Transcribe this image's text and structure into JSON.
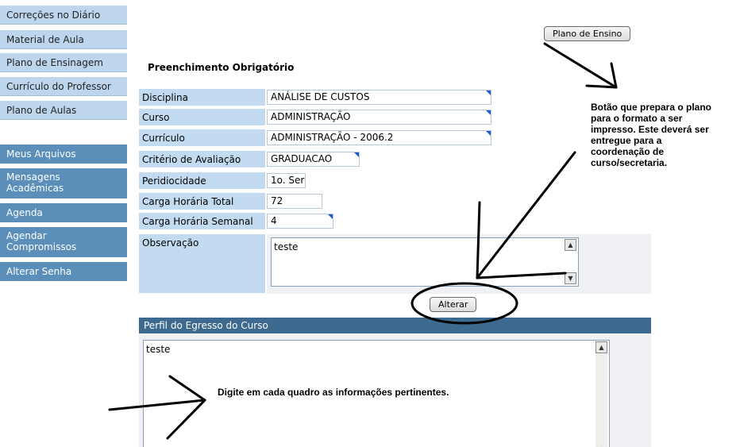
{
  "menu": {
    "light_items": [
      "Correções no Diário",
      "Material de Aula",
      "Plano de Ensinagem",
      "Currículo do Professor",
      "Plano de Aulas"
    ],
    "dark_items": [
      "Meus Arquivos",
      "Mensagens Acadêmicas",
      "Agenda",
      "Agendar Compromissos",
      "Alterar Senha"
    ]
  },
  "form": {
    "heading": "Preenchimento Obrigatório",
    "fields": [
      {
        "label": "Disciplina",
        "value": "ANÁLISE DE CUSTOS"
      },
      {
        "label": "Curso",
        "value": "ADMINISTRAÇÃO"
      },
      {
        "label": "Currículo",
        "value": "ADMINISTRAÇÃO - 2006.2"
      },
      {
        "label": "Critério de Avaliação",
        "value": "GRADUACAO"
      },
      {
        "label": "Peridiocidade",
        "value": "1o. Ser"
      },
      {
        "label": "Carga Horária Total",
        "value": "72"
      },
      {
        "label": "Carga Horária Semanal",
        "value": "4"
      }
    ],
    "observacao_label": "Observação",
    "observacao_value": "teste",
    "alterar_label": "Alterar"
  },
  "plano_button_label": "Plano de Ensino",
  "perfil": {
    "header": "Perfil do Egresso do Curso",
    "value": "teste"
  },
  "annotations": {
    "plano_note": [
      "Botão que prepara o plano",
      "para o formato a ser",
      "impresso. Este deverá ser",
      "entregue para a",
      "coordenação de",
      "curso/secretaria."
    ],
    "digite_note": "Digite em cada quadro as informações pertinentes."
  },
  "icons": {
    "scroll_up": "scroll-up-arrow-icon",
    "scroll_down": "scroll-down-arrow-icon"
  }
}
